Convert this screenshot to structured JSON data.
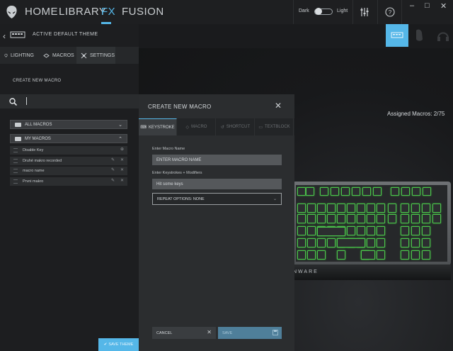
{
  "nav": {
    "home": "HOME",
    "library": "LIBRARY",
    "fx": "FX",
    "fusion": "FUSION"
  },
  "theme_toggle": {
    "dark": "Dark",
    "light": "Light"
  },
  "window": {
    "minimize": "–",
    "maximize": "□",
    "close": "✕"
  },
  "header": {
    "title": "ACTIVE DEFAULT THEME"
  },
  "tabs": [
    {
      "label": "LIGHTING"
    },
    {
      "label": "MACROS"
    },
    {
      "label": "SETTINGS"
    }
  ],
  "panel": {
    "create_title": "CREATE NEW MACRO"
  },
  "groups": {
    "all": "ALL MACROS",
    "mine": "MY MACROS"
  },
  "macros": [
    {
      "name": "Disable Key"
    },
    {
      "name": "Druhé makro recorded"
    },
    {
      "name": "macro name"
    },
    {
      "name": "Prvni makro"
    }
  ],
  "save_theme": "SAVE THEME",
  "assigned": "Assigned Macros:  2/75",
  "keyboard_brand": "NWARE",
  "dialog": {
    "title": "CREATE NEW MACRO",
    "tabs": [
      {
        "label": "KEYSTROKE"
      },
      {
        "label": "MACRO"
      },
      {
        "label": "SHORTCUT"
      },
      {
        "label": "TEXTBLOCK"
      }
    ],
    "name_label": "Enter Macro Name",
    "name_placeholder": "ENTER MACRO NAME",
    "keys_label": "Enter Keystrokes + Modifiers",
    "keys_placeholder": "Hit some keys",
    "repeat": "REPEAT OPTIONS: NONE",
    "cancel": "CANCEL",
    "save": "SAVE"
  },
  "colors": {
    "accent": "#55b7e8",
    "key_glow": "#4cc84c"
  }
}
